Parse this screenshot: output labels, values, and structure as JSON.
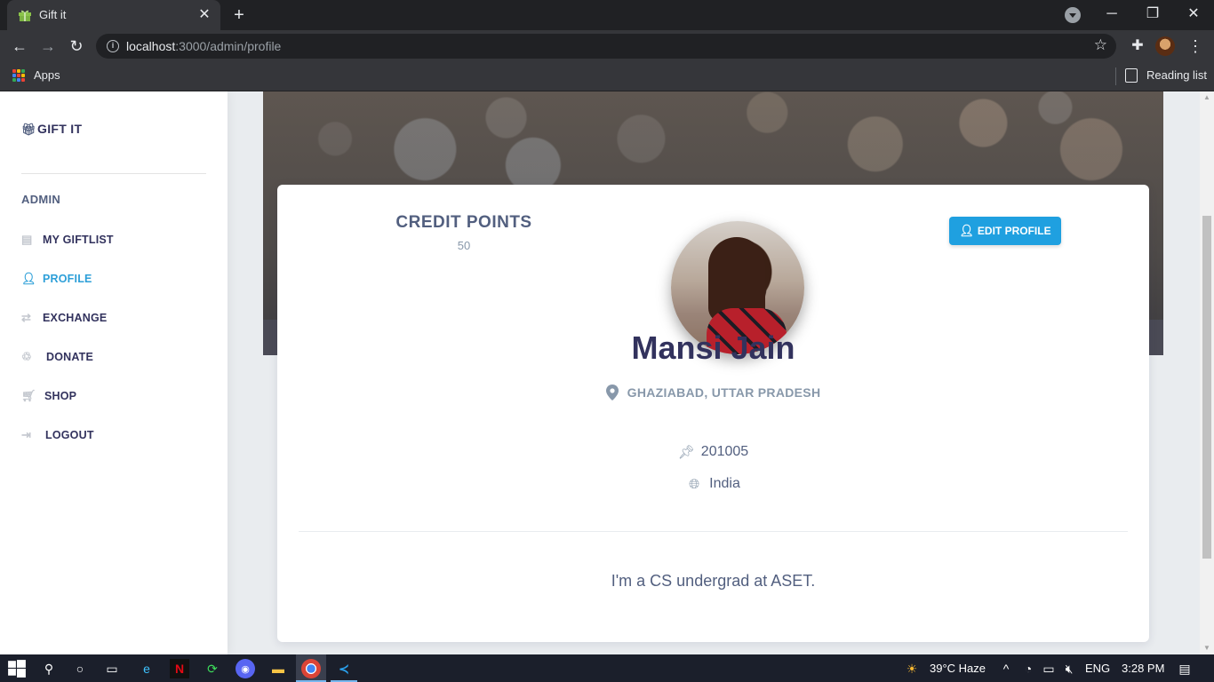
{
  "browser": {
    "tab_title": "Gift it",
    "url_host": "localhost",
    "url_path": ":3000/admin/profile",
    "bookmarks_apps": "Apps",
    "reading_list": "Reading list"
  },
  "sidebar": {
    "brand": "GIFT IT",
    "heading": "ADMIN",
    "items": [
      {
        "label": "MY GIFTLIST",
        "icon": "clipboard-icon"
      },
      {
        "label": "PROFILE",
        "icon": "user-icon",
        "active": true
      },
      {
        "label": "EXCHANGE",
        "icon": "exchange-icon"
      },
      {
        "label": "DONATE",
        "icon": "donate-icon"
      },
      {
        "label": "SHOP",
        "icon": "cart-icon"
      },
      {
        "label": "LOGOUT",
        "icon": "logout-icon"
      }
    ]
  },
  "profile": {
    "credit_title": "CREDIT POINTS",
    "credit_value": "50",
    "edit_label": "EDIT PROFILE",
    "name": "Mansi Jain",
    "location": "GHAZIABAD, UTTAR PRADESH",
    "pincode": "201005",
    "country": "India",
    "bio": "I'm a CS undergrad at ASET."
  },
  "taskbar": {
    "weather": "39°C  Haze",
    "language": "ENG",
    "time": "3:28 PM"
  },
  "colors": {
    "accent": "#1fa0e0",
    "active_nav": "#2d9fd8",
    "heading": "#32325d"
  }
}
